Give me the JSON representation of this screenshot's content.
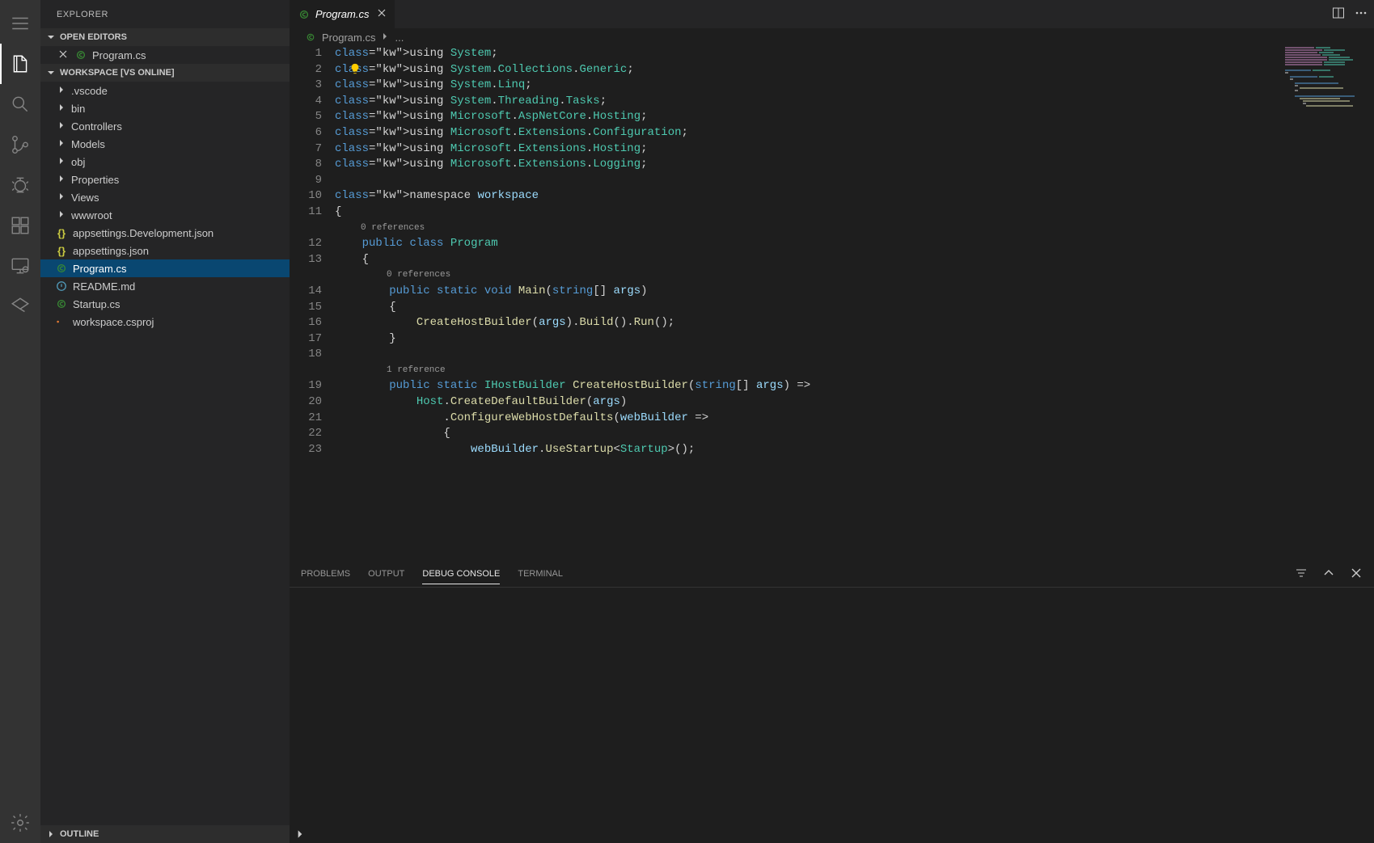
{
  "activity": {
    "items": [
      {
        "name": "menu",
        "active": false
      },
      {
        "name": "explorer",
        "active": true
      },
      {
        "name": "search",
        "active": false
      },
      {
        "name": "source-control",
        "active": false
      },
      {
        "name": "debug",
        "active": false
      },
      {
        "name": "extensions",
        "active": false
      },
      {
        "name": "remote",
        "active": false
      },
      {
        "name": "live-share",
        "active": false
      }
    ],
    "settings": "settings"
  },
  "sidebar": {
    "title": "EXPLORER",
    "openEditorsHeader": "OPEN EDITORS",
    "openEditors": [
      {
        "icon": "cs",
        "label": "Program.cs"
      }
    ],
    "workspaceHeader": "WORKSPACE [VS ONLINE]",
    "tree": [
      {
        "type": "folder",
        "label": ".vscode"
      },
      {
        "type": "folder",
        "label": "bin"
      },
      {
        "type": "folder",
        "label": "Controllers"
      },
      {
        "type": "folder",
        "label": "Models"
      },
      {
        "type": "folder",
        "label": "obj"
      },
      {
        "type": "folder",
        "label": "Properties"
      },
      {
        "type": "folder",
        "label": "Views"
      },
      {
        "type": "folder",
        "label": "wwwroot"
      },
      {
        "type": "file",
        "icon": "json",
        "label": "appsettings.Development.json"
      },
      {
        "type": "file",
        "icon": "json",
        "label": "appsettings.json"
      },
      {
        "type": "file",
        "icon": "cs",
        "label": "Program.cs",
        "selected": true
      },
      {
        "type": "file",
        "icon": "readme",
        "label": "README.md"
      },
      {
        "type": "file",
        "icon": "cs",
        "label": "Startup.cs"
      },
      {
        "type": "file",
        "icon": "csproj",
        "label": "workspace.csproj"
      }
    ],
    "outlineHeader": "OUTLINE"
  },
  "tabs": {
    "open": [
      {
        "icon": "cs",
        "label": "Program.cs"
      }
    ]
  },
  "breadcrumb": {
    "file": "Program.cs",
    "sep": "›",
    "rest": "..."
  },
  "codelens": {
    "class": "0 references",
    "main": "0 references",
    "chb": "1 reference"
  },
  "code": {
    "lines": [
      "using System;",
      "using System.Collections.Generic;",
      "using System.Linq;",
      "using System.Threading.Tasks;",
      "using Microsoft.AspNetCore.Hosting;",
      "using Microsoft.Extensions.Configuration;",
      "using Microsoft.Extensions.Hosting;",
      "using Microsoft.Extensions.Logging;",
      "",
      "namespace workspace",
      "{",
      "    public class Program",
      "    {",
      "        public static void Main(string[] args)",
      "        {",
      "            CreateHostBuilder(args).Build().Run();",
      "        }",
      "",
      "        public static IHostBuilder CreateHostBuilder(string[] args) =>",
      "            Host.CreateDefaultBuilder(args)",
      "                .ConfigureWebHostDefaults(webBuilder =>",
      "                {",
      "                    webBuilder.UseStartup<Startup>();"
    ],
    "lineNumbers": [
      1,
      2,
      3,
      4,
      5,
      6,
      7,
      8,
      9,
      10,
      11,
      12,
      13,
      14,
      15,
      16,
      17,
      18,
      19,
      20,
      21,
      22,
      23
    ]
  },
  "panel": {
    "tabs": [
      "PROBLEMS",
      "OUTPUT",
      "DEBUG CONSOLE",
      "TERMINAL"
    ],
    "active": "DEBUG CONSOLE"
  }
}
